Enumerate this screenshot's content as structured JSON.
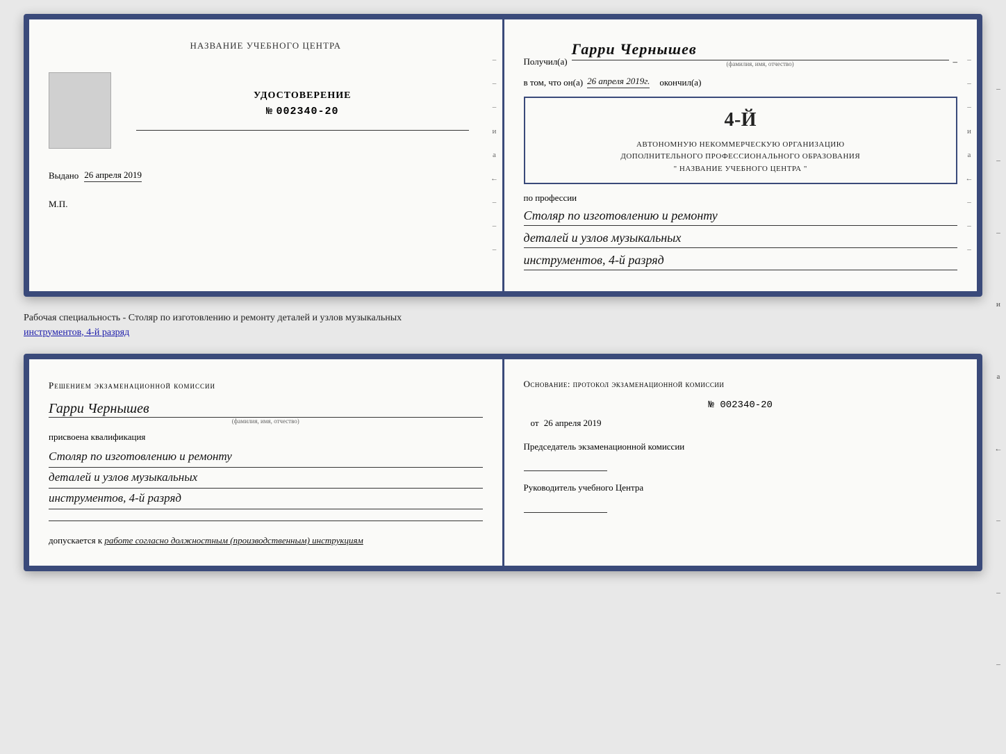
{
  "top_spread": {
    "left_page": {
      "org_title": "НАЗВАНИЕ УЧЕБНОГО ЦЕНТРА",
      "cert_title": "УДОСТОВЕРЕНИЕ",
      "cert_number_prefix": "№",
      "cert_number": "002340-20",
      "vydano_label": "Выдано",
      "vydano_date": "26 апреля 2019",
      "mp_label": "М.П."
    },
    "right_page": {
      "poluchil_label": "Получил(а)",
      "recipient_name": "Гарри Чернышев",
      "fio_sublabel": "(фамилия, имя, отчество)",
      "vtom_label": "в том, что он(а)",
      "vtom_date": "26 апреля 2019г.",
      "okonchil_label": "окончил(а)",
      "stamp_line1": "АВТОНОМНУЮ НЕКОММЕРЧЕСКУЮ ОРГАНИЗАЦИЮ",
      "stamp_line2": "ДОПОЛНИТЕЛЬНОГО ПРОФЕССИОНАЛЬНОГО ОБРАЗОВАНИЯ",
      "stamp_line3": "\" НАЗВАНИЕ УЧЕБНОГО ЦЕНТРА \"",
      "stamp_big_num": "4-й",
      "po_professii_label": "по профессии",
      "profession_line1": "Столяр по изготовлению и ремонту",
      "profession_line2": "деталей и узлов музыкальных",
      "profession_line3": "инструментов, 4-й разряд"
    }
  },
  "description": {
    "text": "Рабочая специальность - Столяр по изготовлению и ремонту деталей и узлов музыкальных",
    "text2": "инструментов, 4-й разряд"
  },
  "bottom_spread": {
    "left_page": {
      "komissia_title": "Решением  экзаменационной  комиссии",
      "person_name": "Гарри Чернышев",
      "fio_sublabel": "(фамилия, имя, отчество)",
      "prisvoena": "присвоена квалификация",
      "kvalif_line1": "Столяр по изготовлению и ремонту",
      "kvalif_line2": "деталей и узлов музыкальных",
      "kvalif_line3": "инструментов, 4-й разряд",
      "dopuskaetsya_label": "допускается к",
      "dopuskaetsya_value": "работе согласно должностным (производственным) инструкциям"
    },
    "right_page": {
      "osnovanie_title": "Основание: протокол экзаменационной комиссии",
      "protocol_number": "№  002340-20",
      "ot_label": "от",
      "ot_date": "26 апреля 2019",
      "predsedatel_title": "Председатель экзаменационной комиссии",
      "rukovoditel_title": "Руководитель учебного Центра"
    }
  },
  "side_dashes": [
    "–",
    "–",
    "–",
    "и",
    "а",
    "←",
    "–",
    "–",
    "–",
    "–",
    "–"
  ]
}
